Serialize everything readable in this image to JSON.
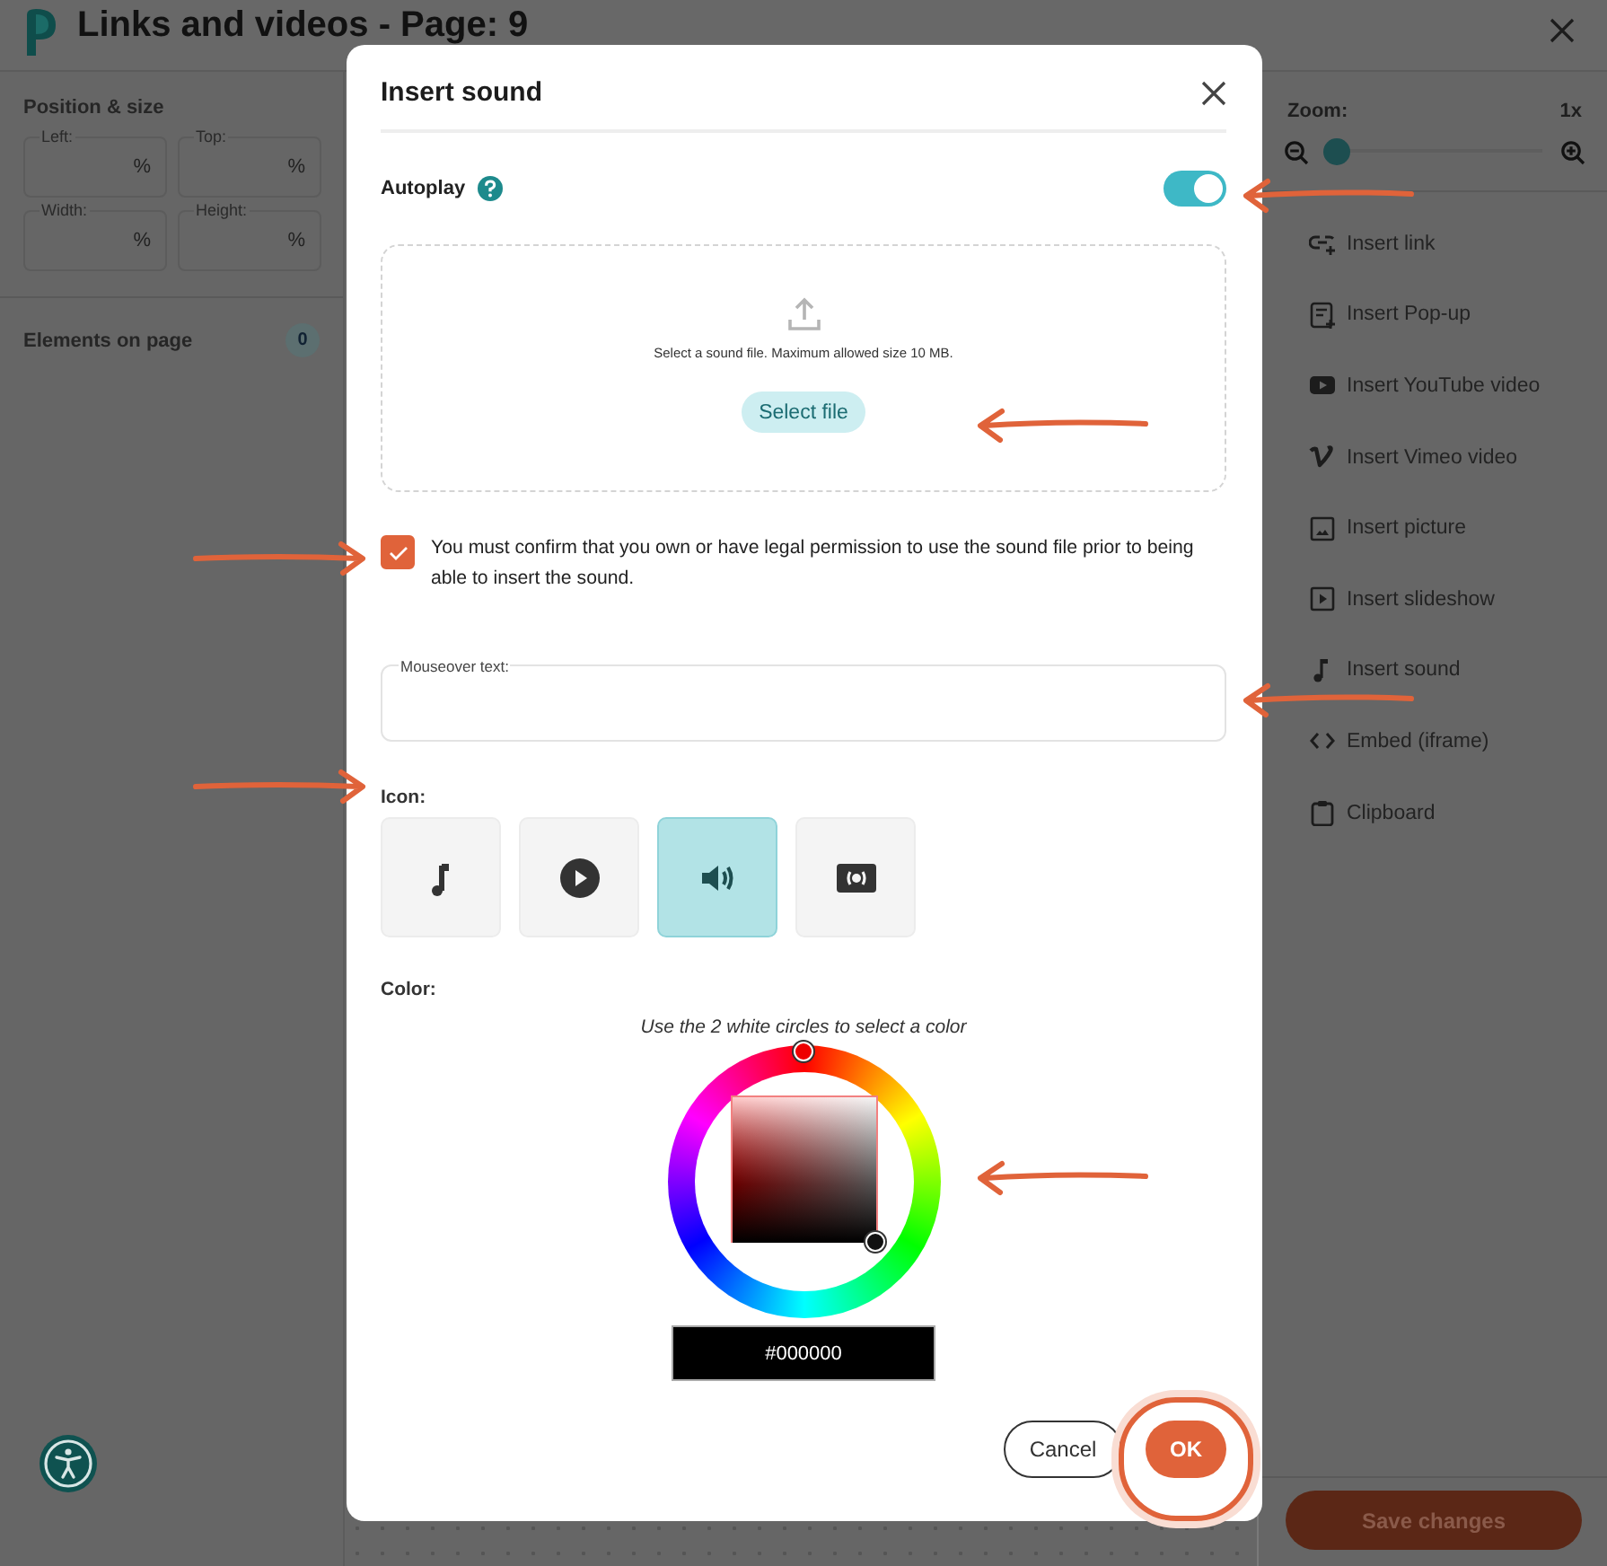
{
  "app": {
    "title": "Links and videos - Page: 9"
  },
  "left_panel": {
    "heading": "Position & size",
    "fields": [
      {
        "label": "Left:",
        "unit": "%"
      },
      {
        "label": "Top:",
        "unit": "%"
      },
      {
        "label": "Width:",
        "unit": "%"
      },
      {
        "label": "Height:",
        "unit": "%"
      }
    ],
    "elements": {
      "label": "Elements on page",
      "count": "0"
    }
  },
  "right_panel": {
    "zoom": {
      "label": "Zoom:",
      "reading": "1x",
      "level": 0.04
    },
    "items": [
      {
        "kind": "link",
        "label": "Insert link"
      },
      {
        "kind": "popup",
        "label": "Insert Pop-up"
      },
      {
        "kind": "youtube",
        "label": "Insert YouTube video"
      },
      {
        "kind": "vimeo",
        "label": "Insert Vimeo video"
      },
      {
        "kind": "picture",
        "label": "Insert picture"
      },
      {
        "kind": "slideshow",
        "label": "Insert slideshow"
      },
      {
        "kind": "sound",
        "label": "Insert sound"
      },
      {
        "kind": "embed",
        "label": "Embed (iframe)"
      },
      {
        "kind": "clipboard",
        "label": "Clipboard"
      }
    ],
    "save_button": "Save changes"
  },
  "dialog": {
    "title": "Insert sound",
    "autoplay": {
      "label": "Autoplay",
      "on": true
    },
    "upload": {
      "hint": "Select a sound file. Maximum allowed size 10 MB.",
      "button": "Select file"
    },
    "consent": {
      "checked": true,
      "text": "You must confirm that you own or have legal permission to use the sound file prior to being able to insert the sound."
    },
    "mouseover": {
      "label": "Mouseover text:"
    },
    "icon_picker": {
      "label": "Icon:",
      "options": [
        {
          "kind": "note",
          "selected": false
        },
        {
          "kind": "play",
          "selected": false
        },
        {
          "kind": "speaker",
          "selected": true
        },
        {
          "kind": "broadcast",
          "selected": false
        }
      ]
    },
    "color": {
      "label": "Color:",
      "hint": "Use the 2 white circles to select a color",
      "value": "#000000"
    },
    "buttons": [
      {
        "kind": "secondary",
        "label": "Cancel"
      },
      {
        "kind": "primary",
        "label": "OK"
      }
    ]
  }
}
